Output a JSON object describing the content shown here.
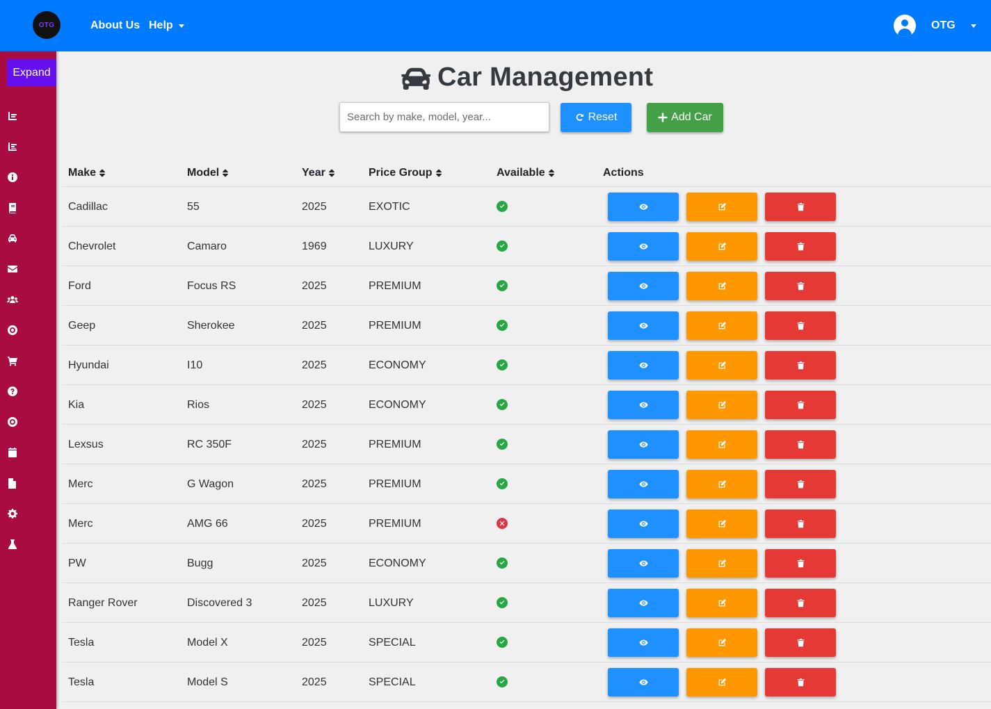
{
  "navbar": {
    "logo_text": "OTG",
    "about_label": "About Us",
    "help_label": "Help",
    "user_name": "OTG"
  },
  "sidebar": {
    "expand_label": "Expand",
    "icons": [
      "chart-area-icon",
      "chart-bar-icon",
      "info-circle-icon",
      "book-icon",
      "car-icon",
      "envelope-icon",
      "users-icon",
      "life-ring-icon",
      "shopping-cart-icon",
      "question-circle-icon",
      "support-icon",
      "calendar-icon",
      "file-icon",
      "cog-icon",
      "flask-icon"
    ]
  },
  "page": {
    "title": "Car Management",
    "search_placeholder": "Search by make, model, year...",
    "reset_label": "Reset",
    "add_label": "Add Car"
  },
  "table": {
    "headers": {
      "make": "Make",
      "model": "Model",
      "year": "Year",
      "price_group": "Price Group",
      "available": "Available",
      "actions": "Actions"
    },
    "rows": [
      {
        "make": "Cadillac",
        "model": "55",
        "year": "2025",
        "price_group": "EXOTIC",
        "available": true
      },
      {
        "make": "Chevrolet",
        "model": "Camaro",
        "year": "1969",
        "price_group": "LUXURY",
        "available": true
      },
      {
        "make": "Ford",
        "model": "Focus RS",
        "year": "2025",
        "price_group": "PREMIUM",
        "available": true
      },
      {
        "make": "Geep",
        "model": "Sherokee",
        "year": "2025",
        "price_group": "PREMIUM",
        "available": true
      },
      {
        "make": "Hyundai",
        "model": "I10",
        "year": "2025",
        "price_group": "ECONOMY",
        "available": true
      },
      {
        "make": "Kia",
        "model": "Rios",
        "year": "2025",
        "price_group": "ECONOMY",
        "available": true
      },
      {
        "make": "Lexsus",
        "model": "RC 350F",
        "year": "2025",
        "price_group": "PREMIUM",
        "available": true
      },
      {
        "make": "Merc",
        "model": "G Wagon",
        "year": "2025",
        "price_group": "PREMIUM",
        "available": true
      },
      {
        "make": "Merc",
        "model": "AMG 66",
        "year": "2025",
        "price_group": "PREMIUM",
        "available": false
      },
      {
        "make": "PW",
        "model": "Bugg",
        "year": "2025",
        "price_group": "ECONOMY",
        "available": true
      },
      {
        "make": "Ranger Rover",
        "model": "Discovered 3",
        "year": "2025",
        "price_group": "LUXURY",
        "available": true
      },
      {
        "make": "Tesla",
        "model": "Model X",
        "year": "2025",
        "price_group": "SPECIAL",
        "available": true
      },
      {
        "make": "Tesla",
        "model": "Model S",
        "year": "2025",
        "price_group": "SPECIAL",
        "available": true
      }
    ]
  },
  "colors": {
    "navbar": "#007bff",
    "sidebar": "#a80c40",
    "expand": "#6610f2",
    "view": "#1e90ff",
    "edit": "#ff9800",
    "delete": "#e53935",
    "add": "#43a047",
    "available_yes": "#28a745",
    "available_no": "#dc3545"
  }
}
